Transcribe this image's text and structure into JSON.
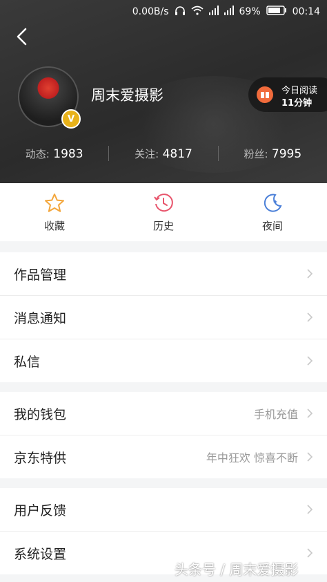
{
  "status_bar": {
    "speed": "0.00B/s",
    "battery": "69%",
    "time": "00:14"
  },
  "profile": {
    "name": "周末爱摄影",
    "badge": "V",
    "reading": {
      "line1": "今日阅读",
      "line2": "11分钟"
    },
    "stats": [
      {
        "label": "动态:",
        "value": "1983"
      },
      {
        "label": "关注:",
        "value": "4817"
      },
      {
        "label": "粉丝:",
        "value": "7995"
      }
    ]
  },
  "quick": [
    {
      "label": "收藏",
      "icon": "star-icon",
      "color": "#f3a63b"
    },
    {
      "label": "历史",
      "icon": "clock-icon",
      "color": "#e8556c"
    },
    {
      "label": "夜间",
      "icon": "moon-icon",
      "color": "#4a7fd8"
    }
  ],
  "menu_groups": [
    {
      "items": [
        {
          "title": "作品管理",
          "hint": ""
        },
        {
          "title": "消息通知",
          "hint": ""
        },
        {
          "title": "私信",
          "hint": ""
        }
      ]
    },
    {
      "items": [
        {
          "title": "我的钱包",
          "hint": "手机充值"
        },
        {
          "title": "京东特供",
          "hint": "年中狂欢 惊喜不断"
        }
      ]
    },
    {
      "items": [
        {
          "title": "用户反馈",
          "hint": ""
        },
        {
          "title": "系统设置",
          "hint": ""
        }
      ]
    }
  ],
  "watermark": "头条号 / 周末爱摄影"
}
